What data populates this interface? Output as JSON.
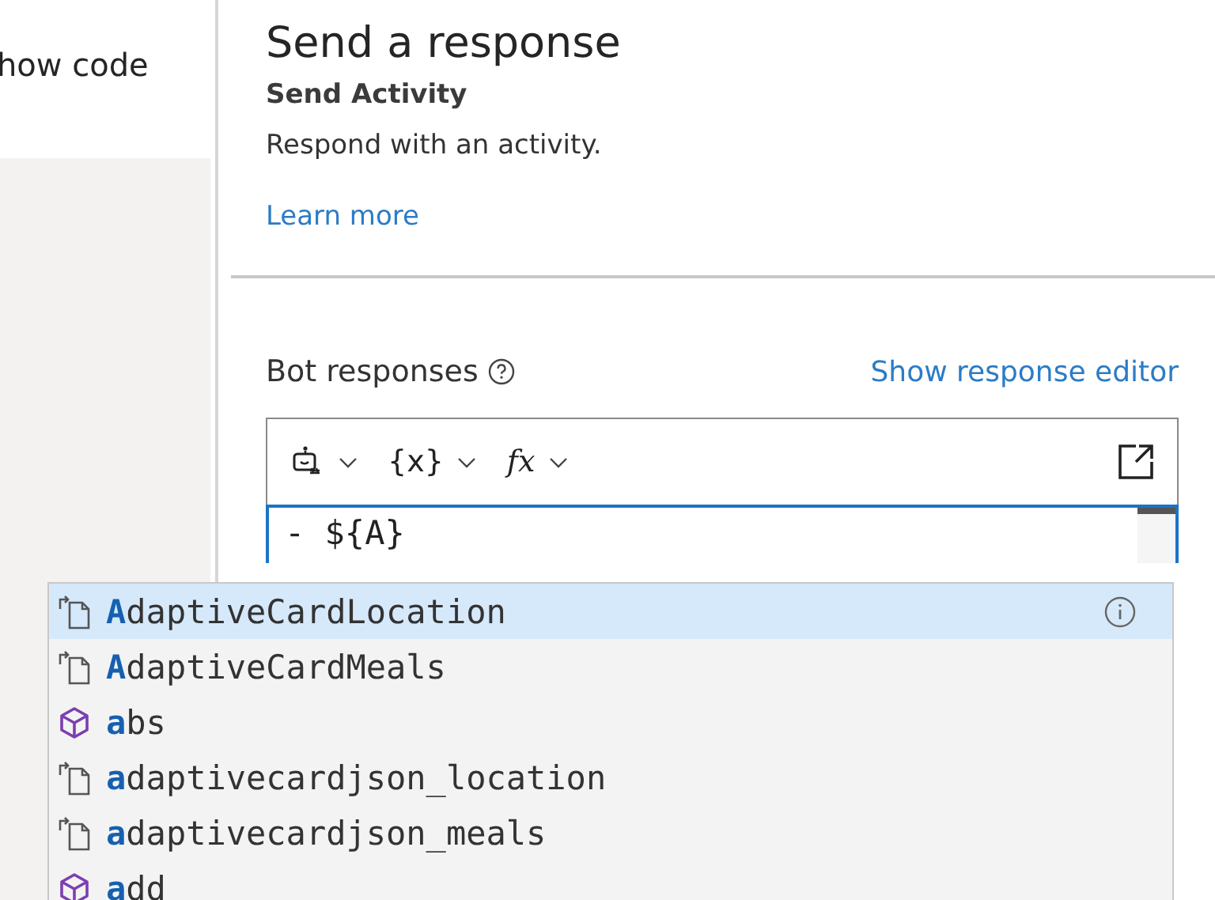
{
  "left_pane": {
    "show_code_link": "how code"
  },
  "panel": {
    "title": "Send a response",
    "subtitle": "Send Activity",
    "description": "Respond with an activity.",
    "learn_more": "Learn more"
  },
  "bot_responses": {
    "label": "Bot responses",
    "show_editor_link": "Show response editor",
    "toolbar": [
      {
        "kind": "bot"
      },
      {
        "kind": "variable",
        "label": "{x}"
      },
      {
        "kind": "function",
        "label": "fx"
      }
    ],
    "code_line": "- ${A}"
  },
  "suggestions": [
    {
      "kind": "snippet",
      "text": "**A**daptiveCardLocation",
      "selected": true
    },
    {
      "kind": "snippet",
      "text": "**A**daptiveCardMeals",
      "selected": false
    },
    {
      "kind": "function",
      "text": "**a**bs",
      "selected": false
    },
    {
      "kind": "snippet",
      "text": "**a**daptivecardjson_location",
      "selected": false
    },
    {
      "kind": "snippet",
      "text": "**a**daptivecardjson_meals",
      "selected": false
    },
    {
      "kind": "function",
      "text": "**a**dd",
      "selected": false
    }
  ]
}
